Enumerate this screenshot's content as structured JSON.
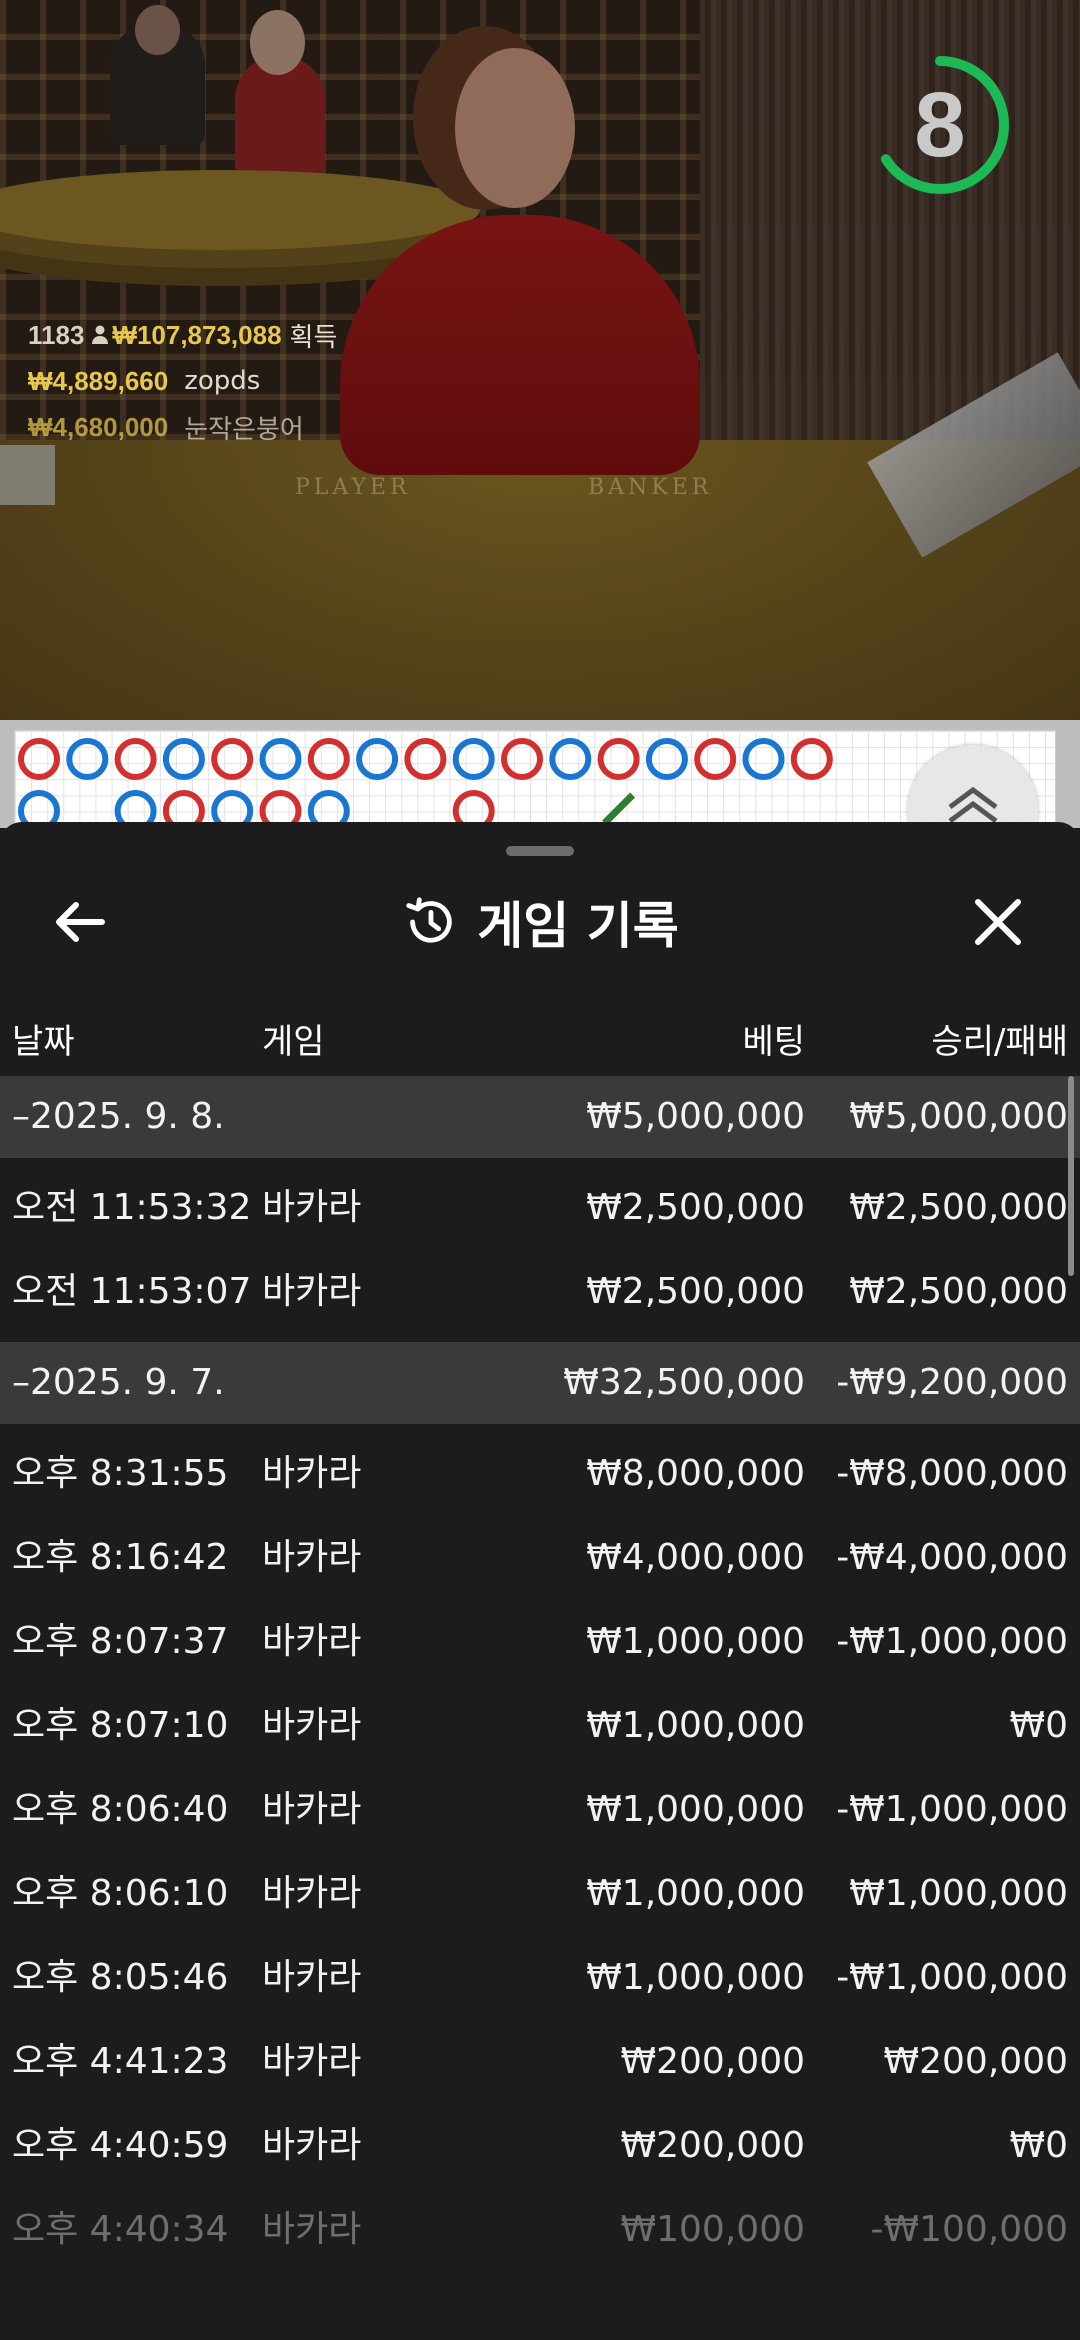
{
  "timer": {
    "seconds": "8",
    "progress": 0.66,
    "color": "#1db954"
  },
  "winners": {
    "top": {
      "count": "1183",
      "amount": "₩107,873,088",
      "label": "획득"
    },
    "list": [
      {
        "amount": "₩4,889,660",
        "name": "zopds"
      },
      {
        "amount": "₩4,680,000",
        "name": "눈작은붕어"
      }
    ]
  },
  "table": {
    "player_label": "PLAYER",
    "banker_label": "BANKER"
  },
  "roadmap": {
    "colors": {
      "banker": "#d32f2f",
      "player": "#1976d2",
      "tie": "#2e7d32"
    },
    "row1": [
      "B",
      "P",
      "B",
      "P",
      "B",
      "P",
      "B",
      "P",
      "B",
      "P",
      "B",
      "P",
      "B",
      "P",
      "B",
      "P",
      "B"
    ],
    "row2": [
      "P",
      "",
      "P",
      "B",
      "P",
      "B",
      "P",
      "",
      "",
      "B",
      "",
      "",
      "T"
    ]
  },
  "sheet": {
    "title": "게임 기록",
    "icons": {
      "back": "arrow-left-icon",
      "title": "history-icon",
      "close": "close-icon"
    },
    "columns": {
      "date": "날짜",
      "game": "게임",
      "bet": "베팅",
      "result": "승리/패배"
    },
    "rows": [
      {
        "type": "group",
        "date": "–2025. 9. 8.",
        "bet": "₩5,000,000",
        "result": "₩5,000,000"
      },
      {
        "type": "item",
        "date": "오전 11:53:32",
        "game": "바카라",
        "bet": "₩2,500,000",
        "result": "₩2,500,000"
      },
      {
        "type": "item",
        "date": "오전 11:53:07",
        "game": "바카라",
        "bet": "₩2,500,000",
        "result": "₩2,500,000"
      },
      {
        "type": "group",
        "date": "–2025. 9. 7.",
        "bet": "₩32,500,000",
        "result": "-₩9,200,000"
      },
      {
        "type": "item",
        "date": "오후 8:31:55",
        "game": "바카라",
        "bet": "₩8,000,000",
        "result": "-₩8,000,000"
      },
      {
        "type": "item",
        "date": "오후 8:16:42",
        "game": "바카라",
        "bet": "₩4,000,000",
        "result": "-₩4,000,000"
      },
      {
        "type": "item",
        "date": "오후 8:07:37",
        "game": "바카라",
        "bet": "₩1,000,000",
        "result": "-₩1,000,000"
      },
      {
        "type": "item",
        "date": "오후 8:07:10",
        "game": "바카라",
        "bet": "₩1,000,000",
        "result": "₩0"
      },
      {
        "type": "item",
        "date": "오후 8:06:40",
        "game": "바카라",
        "bet": "₩1,000,000",
        "result": "-₩1,000,000"
      },
      {
        "type": "item",
        "date": "오후 8:06:10",
        "game": "바카라",
        "bet": "₩1,000,000",
        "result": "₩1,000,000"
      },
      {
        "type": "item",
        "date": "오후 8:05:46",
        "game": "바카라",
        "bet": "₩1,000,000",
        "result": "-₩1,000,000"
      },
      {
        "type": "item",
        "date": "오후 4:41:23",
        "game": "바카라",
        "bet": "₩200,000",
        "result": "₩200,000"
      },
      {
        "type": "item",
        "date": "오후 4:40:59",
        "game": "바카라",
        "bet": "₩200,000",
        "result": "₩0"
      },
      {
        "type": "item",
        "date": "오후 4:40:34",
        "game": "바카라",
        "bet": "₩100,000",
        "result": "-₩100,000",
        "faded": true
      }
    ]
  }
}
